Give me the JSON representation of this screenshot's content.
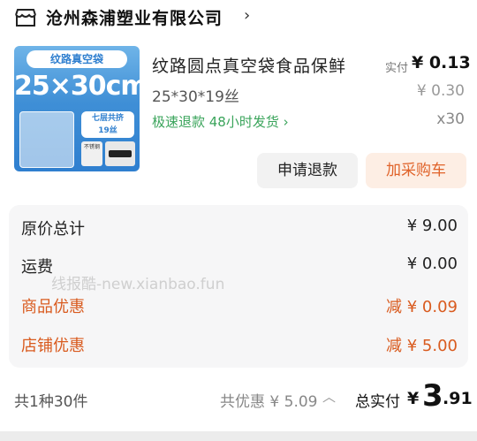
{
  "shop": {
    "name": "沧州森浦塑业有限公司",
    "chevron": "›",
    "icon": "store-icon"
  },
  "product": {
    "image": {
      "tag": "纹路真空袋",
      "size_text": "25×30cm",
      "layers_line1": "七层共挤",
      "layers_line2": "19丝",
      "chip_text": "不锈钢"
    },
    "title": "纹路圆点真空袋食品保鲜",
    "spec": "25*30*19丝",
    "service": "极速退款  48小时发货 ›",
    "paid_label": "实付",
    "paid_price": "¥ 0.13",
    "original_price": "¥ 0.30",
    "quantity": "x30"
  },
  "actions": {
    "refund": "申请退款",
    "add_cart": "加采购车"
  },
  "summary": {
    "original_total_label": "原价总计",
    "original_total": "¥ 9.00",
    "shipping_label": "运费",
    "shipping": "¥ 0.00",
    "product_discount_label": "商品优惠",
    "product_discount": "减 ¥ 0.09",
    "shop_discount_label": "店铺优惠",
    "shop_discount": "减 ¥ 5.00",
    "watermark": "线报酷-new.xianbao.fun"
  },
  "footer": {
    "count": "共1种30件",
    "savings": "共优惠 ¥ 5.09",
    "savings_arrow": "︿",
    "total_label": "总实付",
    "currency": "¥",
    "total_int": "3",
    "total_dec": ".91"
  },
  "colors": {
    "discount": "#d95b1f",
    "service": "#3aa45b",
    "cart_button": "#e0632a"
  }
}
